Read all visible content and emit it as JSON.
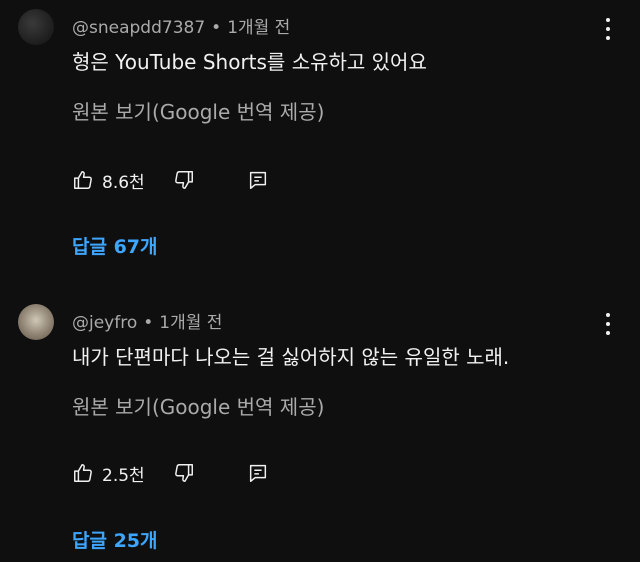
{
  "comments": [
    {
      "username": "@sneapdd7387",
      "separator": "•",
      "time": "1개월 전",
      "text": "형은 YouTube Shorts를 소유하고 있어요",
      "translate_label": "원본 보기(Google 번역 제공)",
      "likes": "8.6천",
      "replies_label": "답글 67개",
      "icons": {
        "like": "thumbs-up-icon",
        "dislike": "thumbs-down-icon",
        "reply": "reply-icon",
        "menu": "more-vert-icon"
      }
    },
    {
      "username": "@jeyfro",
      "separator": "•",
      "time": "1개월 전",
      "text": "내가 단편마다 나오는 걸 싫어하지 않는 유일한 노래.",
      "translate_label": "원본 보기(Google 번역 제공)",
      "likes": "2.5천",
      "replies_label": "답글 25개",
      "icons": {
        "like": "thumbs-up-icon",
        "dislike": "thumbs-down-icon",
        "reply": "reply-icon",
        "menu": "more-vert-icon"
      }
    }
  ],
  "colors": {
    "background": "#0f0f0f",
    "primary_text": "#f1f1f1",
    "secondary_text": "#aaaaaa",
    "link": "#3ea6ff"
  }
}
